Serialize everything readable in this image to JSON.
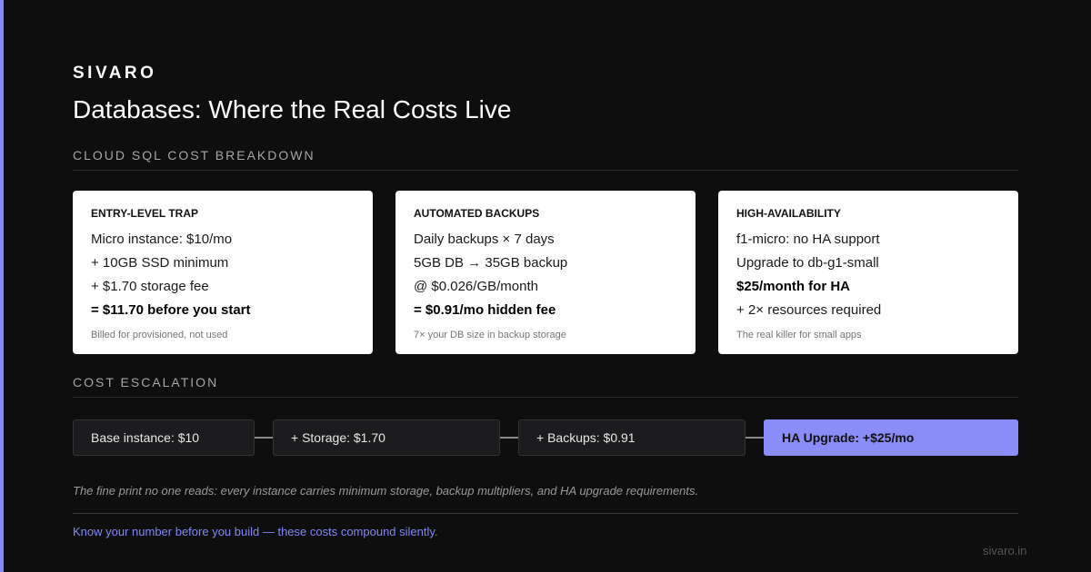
{
  "brand": "SIVARO",
  "title": "Databases: Where the Real Costs Live",
  "section_breakdown": "CLOUD SQL COST BREAKDOWN",
  "cards": [
    {
      "title": "ENTRY-LEVEL TRAP",
      "lines": [
        "Micro instance: $10/mo",
        "+ 10GB SSD minimum",
        "+ $1.70 storage fee",
        "= $11.70 before you start"
      ],
      "note": "Billed for provisioned, not used"
    },
    {
      "title": "AUTOMATED BACKUPS",
      "lines": [
        "Daily backups × 7 days",
        "5GB DB → 35GB backup",
        "@ $0.026/GB/month",
        "= $0.91/mo hidden fee"
      ],
      "note": "7× your DB size in backup storage"
    },
    {
      "title": "HIGH-AVAILABILITY",
      "lines": [
        "f1-micro: no HA support",
        "Upgrade to db-g1-small",
        "$25/month for HA",
        "+ 2× resources required"
      ],
      "note": "The real killer for small apps"
    }
  ],
  "section_escalation": "COST ESCALATION",
  "escalation": [
    "Base instance: $10",
    "+ Storage: $1.70",
    "+ Backups: $0.91",
    "HA Upgrade: +$25/mo"
  ],
  "fine_print": "The fine print no one reads: every instance carries minimum storage, backup multipliers, and HA upgrade requirements.",
  "footer_note": "Know your number before you build — these costs compound silently.",
  "site": "sivaro.in",
  "colors": {
    "background": "#0e0e0e",
    "accent": "#8388f4",
    "card": "#ffffff"
  }
}
